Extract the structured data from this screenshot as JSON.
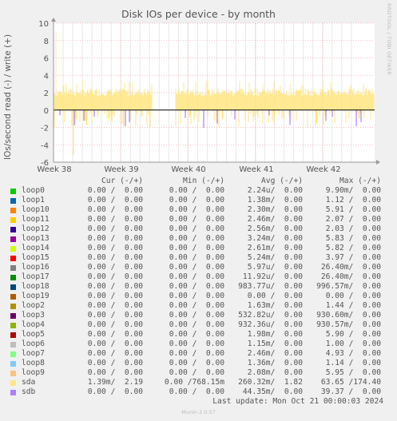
{
  "title": "Disk IOs per device - by month",
  "side_label": "RRDTOOL / TOBI OETIKER",
  "footer": "Munin 2.0.57",
  "last_update": "Last update:  Mon Oct 21 00:00:03 2024",
  "legend_headers": {
    "cur": "Cur (-/+)",
    "min": "Min (-/+)",
    "avg": "Avg (-/+)",
    "max": "Max (-/+)"
  },
  "legend": [
    {
      "name": "loop0",
      "color": "#00cc00",
      "cur": "0.00 /  0.00",
      "min": "0.00 /  0.00",
      "avg": "2.24u/  0.00",
      "max": "9.90m/  0.00"
    },
    {
      "name": "loop1",
      "color": "#0066b3",
      "cur": "0.00 /  0.00",
      "min": "0.00 /  0.00",
      "avg": "1.38m/  0.00",
      "max": "1.12 /  0.00"
    },
    {
      "name": "loop10",
      "color": "#ff8000",
      "cur": "0.00 /  0.00",
      "min": "0.00 /  0.00",
      "avg": "2.30m/  0.00",
      "max": "5.91 /  0.00"
    },
    {
      "name": "loop11",
      "color": "#ffcc00",
      "cur": "0.00 /  0.00",
      "min": "0.00 /  0.00",
      "avg": "2.46m/  0.00",
      "max": "2.07 /  0.00"
    },
    {
      "name": "loop12",
      "color": "#330099",
      "cur": "0.00 /  0.00",
      "min": "0.00 /  0.00",
      "avg": "2.56m/  0.00",
      "max": "2.03 /  0.00"
    },
    {
      "name": "loop13",
      "color": "#990099",
      "cur": "0.00 /  0.00",
      "min": "0.00 /  0.00",
      "avg": "3.24m/  0.00",
      "max": "5.83 /  0.00"
    },
    {
      "name": "loop14",
      "color": "#ccff00",
      "cur": "0.00 /  0.00",
      "min": "0.00 /  0.00",
      "avg": "2.61m/  0.00",
      "max": "5.82 /  0.00"
    },
    {
      "name": "loop15",
      "color": "#ff0000",
      "cur": "0.00 /  0.00",
      "min": "0.00 /  0.00",
      "avg": "5.24m/  0.00",
      "max": "3.97 /  0.00"
    },
    {
      "name": "loop16",
      "color": "#808080",
      "cur": "0.00 /  0.00",
      "min": "0.00 /  0.00",
      "avg": "5.97u/  0.00",
      "max": "26.40m/  0.00"
    },
    {
      "name": "loop17",
      "color": "#008f00",
      "cur": "0.00 /  0.00",
      "min": "0.00 /  0.00",
      "avg": "11.92u/  0.00",
      "max": "26.40m/  0.00"
    },
    {
      "name": "loop18",
      "color": "#00487d",
      "cur": "0.00 /  0.00",
      "min": "0.00 /  0.00",
      "avg": "983.77u/  0.00",
      "max": "996.57m/  0.00"
    },
    {
      "name": "loop19",
      "color": "#b35a00",
      "cur": "0.00 /  0.00",
      "min": "0.00 /  0.00",
      "avg": "0.00 /  0.00",
      "max": "0.00 /  0.00"
    },
    {
      "name": "loop2",
      "color": "#b38f00",
      "cur": "0.00 /  0.00",
      "min": "0.00 /  0.00",
      "avg": "1.63m/  0.00",
      "max": "1.44 /  0.00"
    },
    {
      "name": "loop3",
      "color": "#6b006b",
      "cur": "0.00 /  0.00",
      "min": "0.00 /  0.00",
      "avg": "532.82u/  0.00",
      "max": "930.60m/  0.00"
    },
    {
      "name": "loop4",
      "color": "#8fb300",
      "cur": "0.00 /  0.00",
      "min": "0.00 /  0.00",
      "avg": "932.36u/  0.00",
      "max": "930.57m/  0.00"
    },
    {
      "name": "loop5",
      "color": "#b30000",
      "cur": "0.00 /  0.00",
      "min": "0.00 /  0.00",
      "avg": "1.98m/  0.00",
      "max": "5.90 /  0.00"
    },
    {
      "name": "loop6",
      "color": "#bebebe",
      "cur": "0.00 /  0.00",
      "min": "0.00 /  0.00",
      "avg": "1.15m/  0.00",
      "max": "1.00 /  0.00"
    },
    {
      "name": "loop7",
      "color": "#80ff80",
      "cur": "0.00 /  0.00",
      "min": "0.00 /  0.00",
      "avg": "2.46m/  0.00",
      "max": "4.93 /  0.00"
    },
    {
      "name": "loop8",
      "color": "#80c9ff",
      "cur": "0.00 /  0.00",
      "min": "0.00 /  0.00",
      "avg": "1.36m/  0.00",
      "max": "1.14 /  0.00"
    },
    {
      "name": "loop9",
      "color": "#ffc080",
      "cur": "0.00 /  0.00",
      "min": "0.00 /  0.00",
      "avg": "2.08m/  0.00",
      "max": "5.95 /  0.00"
    },
    {
      "name": "sda",
      "color": "#ffe680",
      "cur": "1.39m/  2.19",
      "min": "0.00 /768.15m",
      "avg": "260.32m/  1.82",
      "max": "63.65 /174.40"
    },
    {
      "name": "sdb",
      "color": "#aa80ff",
      "cur": "0.00 /  0.00",
      "min": "0.00 /  0.00",
      "avg": "44.35m/  0.00",
      "max": "39.37 /  0.00"
    }
  ],
  "chart_data": {
    "type": "line",
    "title": "Disk IOs per device - by month",
    "ylabel": "IOs/second read (-) / write (+)",
    "ylim": [
      -6,
      10
    ],
    "yticks": [
      -6,
      -4,
      -2,
      0,
      2,
      4,
      6,
      8,
      10
    ],
    "xlabels": [
      "Week 38",
      "Week 39",
      "Week 40",
      "Week 41",
      "Week 42"
    ],
    "grid": true,
    "colors": {
      "background": "#f0f0f0",
      "plot": "#ffffff",
      "grid": "#eeaaaa",
      "axis": "#000000",
      "write": "#ffe680",
      "read_spikes": "#aa80ff"
    },
    "series": [
      {
        "name": "sda",
        "description": "write (+) approx. 2 IOs/s with gap around Week 39-40",
        "write_baseline": 2.0
      },
      {
        "name": "sdb",
        "description": "occasional read (-) spikes"
      }
    ],
    "gap_weeks": [
      "Week 39",
      "Week 40"
    ]
  }
}
